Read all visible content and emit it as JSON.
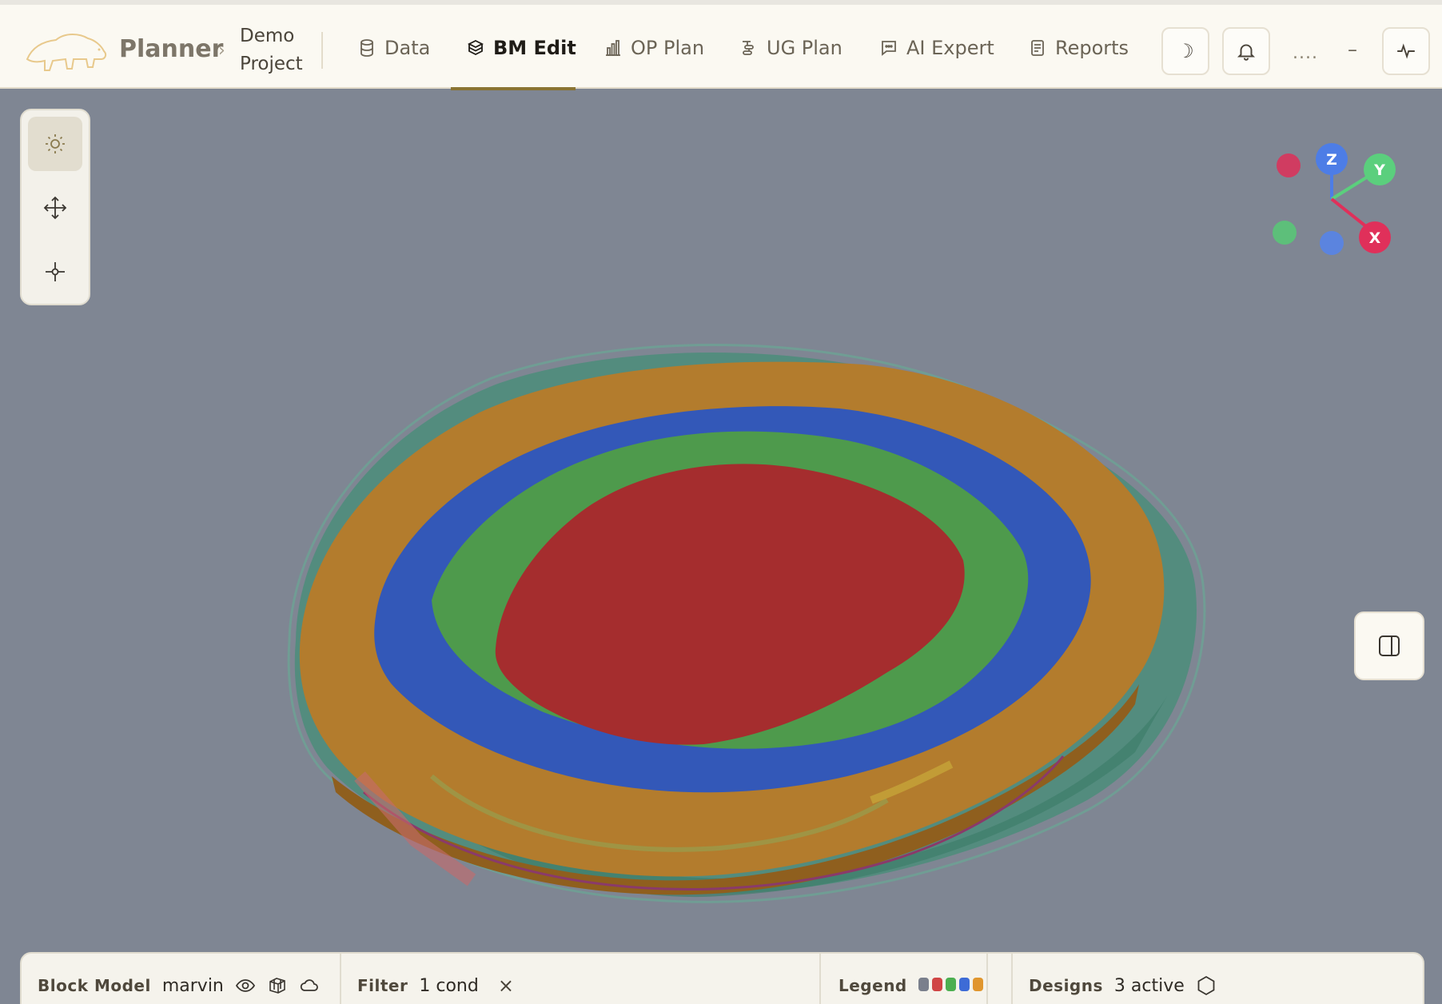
{
  "app": {
    "brand": "Planner",
    "breadcrumb_sep": "›",
    "project": "Demo Project"
  },
  "tabs": [
    {
      "label": "Data",
      "icon": "database-icon",
      "active": false
    },
    {
      "label": "BM Edit",
      "icon": "cube-icon",
      "active": true
    },
    {
      "label": "OP Plan",
      "icon": "bar-chart-icon",
      "active": false
    },
    {
      "label": "UG Plan",
      "icon": "underground-icon",
      "active": false
    },
    {
      "label": "AI Expert",
      "icon": "chat-icon",
      "active": false
    },
    {
      "label": "Reports",
      "icon": "report-icon",
      "active": false
    }
  ],
  "header_actions": {
    "theme_icon": "☽",
    "bell_icon": "bell-icon",
    "dots": "....",
    "minimize": "–",
    "activity_icon": "pulse-icon"
  },
  "viewport_tools": [
    "sun-icon",
    "move-icon",
    "crosshair-icon"
  ],
  "axis_gizmo": {
    "z": "Z",
    "y": "Y",
    "x": "X"
  },
  "bottom_bar": {
    "block_model": {
      "label": "Block Model",
      "value": "marvin"
    },
    "filter": {
      "label": "Filter",
      "value": "1 cond",
      "clear": "×"
    },
    "legend": {
      "label": "Legend",
      "colors": [
        "#7a7f8c",
        "#d04545",
        "#4caf50",
        "#3d6bd6",
        "#e0962e"
      ]
    },
    "designs": {
      "label": "Designs",
      "value": "3 active"
    }
  },
  "colors": {
    "accent": "#8a7433",
    "ore_high": "#a52d2e",
    "ore_mid": "#4e9a4c",
    "ore_low": "#3358b8",
    "waste": "#b37c2d",
    "surface": "#4e8a78",
    "background": "#7f8693"
  }
}
